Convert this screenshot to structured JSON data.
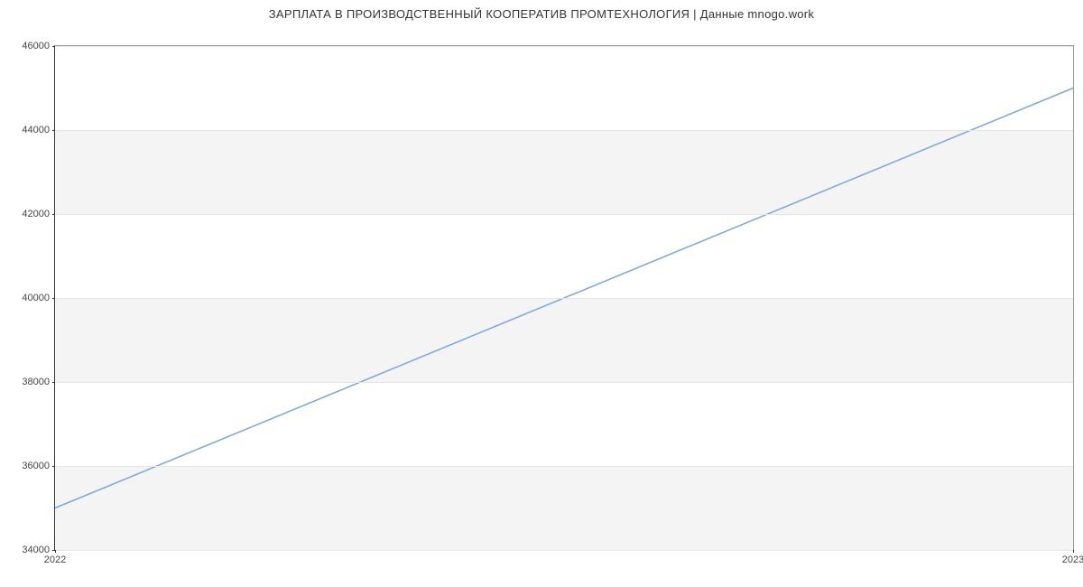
{
  "chart_data": {
    "type": "line",
    "title": "ЗАРПЛАТА В ПРОИЗВОДСТВЕННЫЙ КООПЕРАТИВ ПРОМТЕХНОЛОГИЯ | Данные mnogo.work",
    "xlabel": "",
    "ylabel": "",
    "x": [
      "2022",
      "2023"
    ],
    "values": [
      35000,
      45000
    ],
    "ylim": [
      34000,
      46000
    ],
    "yticks": [
      34000,
      36000,
      38000,
      40000,
      42000,
      44000,
      46000
    ],
    "xticks": [
      "2022",
      "2023"
    ],
    "line_color": "#7ba5e0",
    "band_color": "#f4f4f4"
  }
}
